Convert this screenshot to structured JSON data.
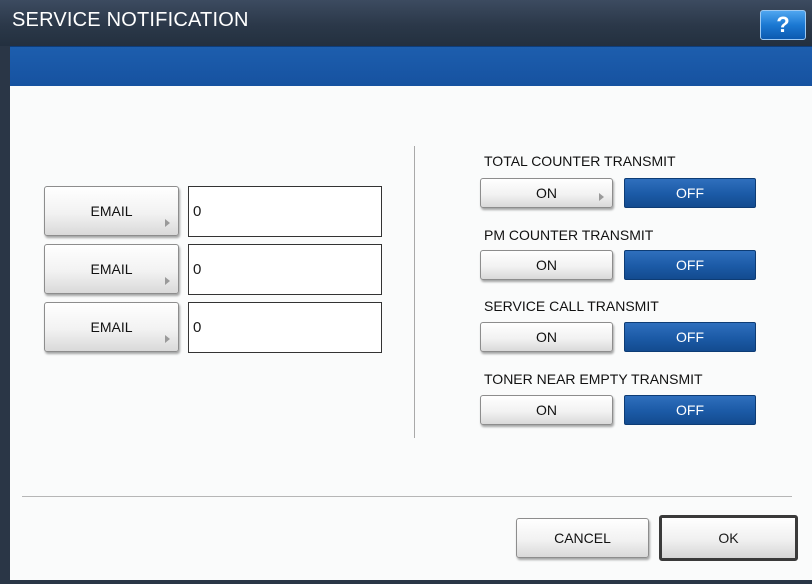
{
  "window": {
    "title": "SERVICE NOTIFICATION",
    "help_label": "?"
  },
  "email_rows": [
    {
      "button_label": "EMAIL",
      "value": "0"
    },
    {
      "button_label": "EMAIL",
      "value": "0"
    },
    {
      "button_label": "EMAIL",
      "value": "0"
    }
  ],
  "transmit_settings": [
    {
      "label": "TOTAL COUNTER TRANSMIT",
      "on_label": "ON",
      "off_label": "OFF",
      "selected": "OFF"
    },
    {
      "label": "PM COUNTER TRANSMIT",
      "on_label": "ON",
      "off_label": "OFF",
      "selected": "OFF"
    },
    {
      "label": "SERVICE CALL TRANSMIT",
      "on_label": "ON",
      "off_label": "OFF",
      "selected": "OFF"
    },
    {
      "label": "TONER NEAR EMPTY TRANSMIT",
      "on_label": "ON",
      "off_label": "OFF",
      "selected": "OFF"
    }
  ],
  "footer": {
    "cancel_label": "CANCEL",
    "ok_label": "OK"
  },
  "colors": {
    "title_bar": "#2b3849",
    "sub_bar": "#1a58a7",
    "selected_toggle": "#1b5aa6",
    "help_button": "#1b78d2"
  }
}
